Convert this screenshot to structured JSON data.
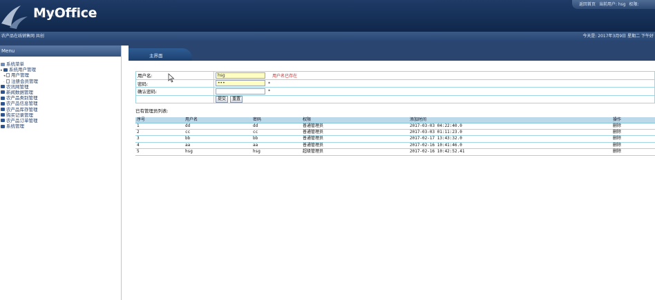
{
  "header": {
    "logo": "MyOffice",
    "top_links": [
      "返回首页",
      "当前用户: hsg",
      "权限:"
    ]
  },
  "infobar": {
    "left": "农产品在线销售网 共创",
    "right": "今天是: 2017年3月9日 星期二 下午好"
  },
  "sidebar": {
    "title": "Menu",
    "items": [
      {
        "label": "系统菜单",
        "level": 0,
        "icon": "root"
      },
      {
        "label": "系统用户管理",
        "level": 0,
        "icon": "folder",
        "expander": "▸"
      },
      {
        "label": "用户管理",
        "level": 1,
        "icon": "page",
        "expander": "◂"
      },
      {
        "label": "注册会员管理",
        "level": 1,
        "icon": "page",
        "expander": "·"
      },
      {
        "label": "农讯网管理",
        "level": 0,
        "icon": "folder"
      },
      {
        "label": "新闻数据管理",
        "level": 0,
        "icon": "folder"
      },
      {
        "label": "农产品类别管理",
        "level": 0,
        "icon": "folder"
      },
      {
        "label": "农产品信息管理",
        "level": 0,
        "icon": "folder"
      },
      {
        "label": "农产品库存管理",
        "level": 0,
        "icon": "folder"
      },
      {
        "label": "购买记录管理",
        "level": 0,
        "icon": "folder"
      },
      {
        "label": "农产品订单管理",
        "level": 0,
        "icon": "folder"
      },
      {
        "label": "系统管理",
        "level": 0,
        "icon": "folder"
      }
    ]
  },
  "tab": {
    "label": "主界面"
  },
  "form": {
    "username_label": "用户名:",
    "username_value": "hsg",
    "username_error": "用户名已存在",
    "password_label": "密码:",
    "password_value": "•••",
    "password_star": "*",
    "confirm_label": "确认密码:",
    "confirm_value": "",
    "confirm_star": "*",
    "submit_label": "提交",
    "reset_label": "重置"
  },
  "list": {
    "title": "已有管理员列表:",
    "columns": [
      "序号",
      "用户名",
      "密码",
      "权限",
      "添加时间",
      "操作"
    ],
    "rows": [
      [
        "1",
        "dd",
        "dd",
        "普通管理员",
        "2017-03-03 04:22:40.0",
        "删除"
      ],
      [
        "2",
        "cc",
        "cc",
        "普通管理员",
        "2017-03-03 01:11:23.0",
        "删除"
      ],
      [
        "3",
        "bb",
        "bb",
        "普通管理员",
        "2017-02-17 13:43:32.0",
        "删除"
      ],
      [
        "4",
        "aa",
        "aa",
        "普通管理员",
        "2017-02-16 10:41:46.0",
        "删除"
      ],
      [
        "5",
        "hsg",
        "hsg",
        "超级管理员",
        "2017-02-16 10:42:52.41",
        "删除"
      ]
    ]
  },
  "colors": {
    "header_bg": "#17325b",
    "table_border": "#9fd4e3",
    "table_header_bg": "#bcd9ea",
    "input_highlight": "#ffffc4",
    "error_text": "#e02020"
  }
}
